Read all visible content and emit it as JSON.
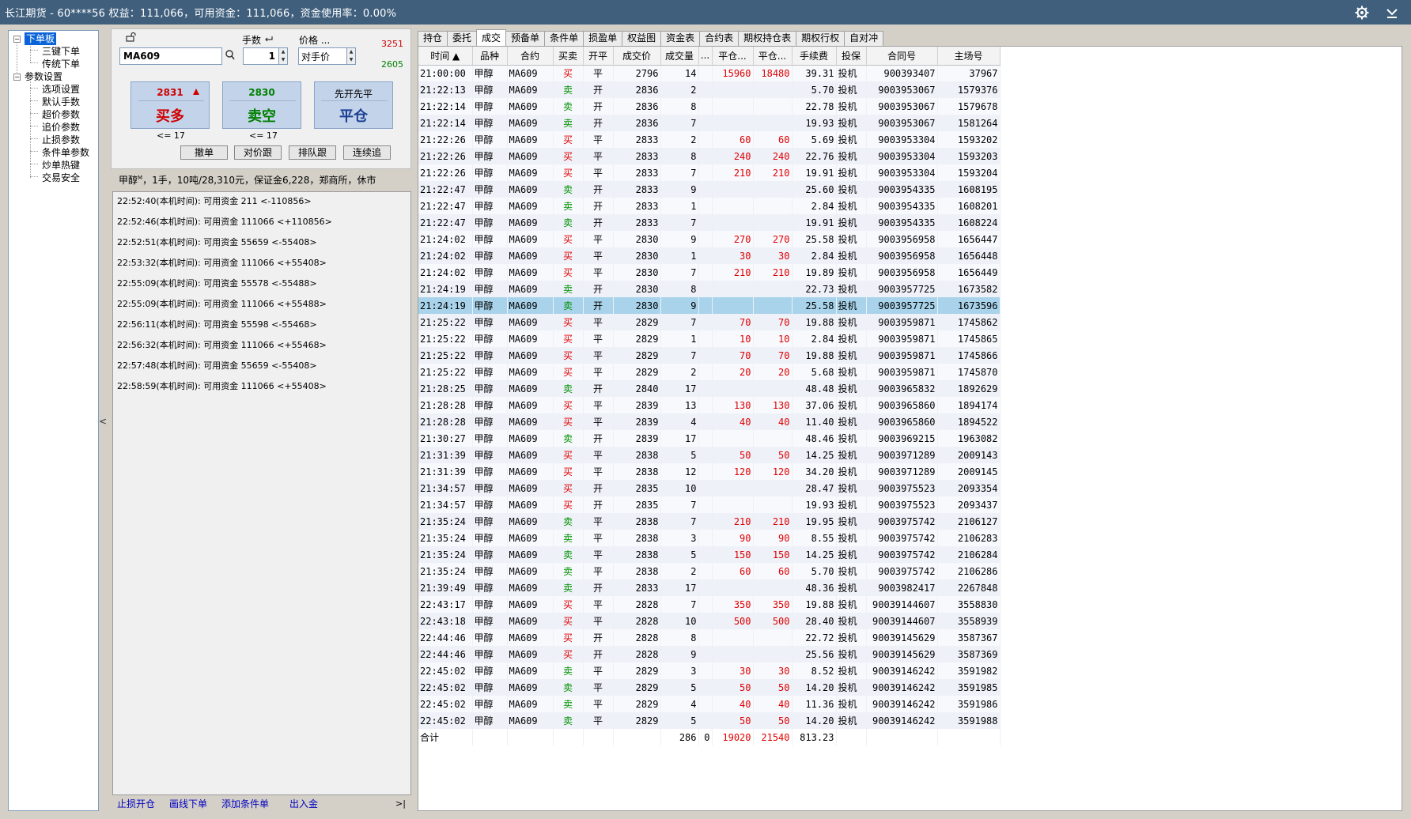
{
  "window": {
    "title": "长江期货 - 60****56  权益：111,066，可用资金：111,066，资金使用率：0.00%",
    "icons": [
      "gear-icon",
      "minimize-icon"
    ]
  },
  "tree": {
    "root1": "下单板",
    "root1_children": [
      "三键下单",
      "传统下单"
    ],
    "root2": "参数设置",
    "root2_children": [
      "选项设置",
      "默认手数",
      "超价参数",
      "追价参数",
      "止损参数",
      "条件单参数",
      "炒单热键",
      "交易安全"
    ]
  },
  "order": {
    "qty_label": "手数",
    "price_label": "价格 ...",
    "contract": "MA609",
    "qty": "1",
    "price_mode": "对手价",
    "limit_up": "3251",
    "limit_down": "2605",
    "buy_price": "2831",
    "buy_label": "买多",
    "sell_price": "2830",
    "sell_label": "卖空",
    "close_hint": "先开先平",
    "close_label": "平仓",
    "buy_limit": "<= 17",
    "sell_limit": "<= 17",
    "buttons": [
      "撤单",
      "对价跟",
      "排队跟",
      "连续追"
    ],
    "info_prefix": "甲醇",
    "info_sup": "M",
    "info_rest": "，1手，10吨/28,310元，保证金6,228，郑商所，休市"
  },
  "log": [
    "22:52:40(本机时间): 可用资金 211 <-110856>",
    "22:52:46(本机时间): 可用资金 111066 <+110856>",
    "22:52:51(本机时间): 可用资金 55659 <-55408>",
    "22:53:32(本机时间): 可用资金 111066 <+55408>",
    "22:55:09(本机时间): 可用资金 55578 <-55488>",
    "22:55:09(本机时间): 可用资金 111066 <+55488>",
    "22:56:11(本机时间): 可用资金 55598 <-55468>",
    "22:56:32(本机时间): 可用资金 111066 <+55468>",
    "22:57:48(本机时间): 可用资金 55659 <-55408>",
    "22:58:59(本机时间): 可用资金 111066 <+55408>"
  ],
  "bottom_links": [
    "止损开仓",
    "画线下单",
    "添加条件单",
    "出入金"
  ],
  "collapse_label": ">|",
  "tabs": [
    "持仓",
    "委托",
    "成交",
    "预备单",
    "条件单",
    "损盈单",
    "权益图",
    "资金表",
    "合约表",
    "期权持仓表",
    "期权行权",
    "自对冲"
  ],
  "active_tab": "成交",
  "columns": [
    "时间 ▲",
    "品种",
    "合约",
    "买卖",
    "开平",
    "成交价",
    "成交量",
    "...",
    "平仓...",
    "平仓...",
    "手续费",
    "投保",
    "合同号",
    "主场号"
  ],
  "colors": {
    "buy": "#e00000",
    "sell": "#009000",
    "selected_row": "#a8d3ea",
    "title_bar": "#3f5f7d"
  },
  "rows": [
    [
      "21:00:00",
      "甲醇",
      "MA609",
      "买",
      "平",
      "2796",
      "14",
      "",
      "15960",
      "18480",
      "39.31",
      "投机",
      "900393407",
      "37967"
    ],
    [
      "21:22:13",
      "甲醇",
      "MA609",
      "卖",
      "开",
      "2836",
      "2",
      "",
      "",
      "",
      "5.70",
      "投机",
      "9003953067",
      "1579376"
    ],
    [
      "21:22:14",
      "甲醇",
      "MA609",
      "卖",
      "开",
      "2836",
      "8",
      "",
      "",
      "",
      "22.78",
      "投机",
      "9003953067",
      "1579678"
    ],
    [
      "21:22:14",
      "甲醇",
      "MA609",
      "卖",
      "开",
      "2836",
      "7",
      "",
      "",
      "",
      "19.93",
      "投机",
      "9003953067",
      "1581264"
    ],
    [
      "21:22:26",
      "甲醇",
      "MA609",
      "买",
      "平",
      "2833",
      "2",
      "",
      "60",
      "60",
      "5.69",
      "投机",
      "9003953304",
      "1593202"
    ],
    [
      "21:22:26",
      "甲醇",
      "MA609",
      "买",
      "平",
      "2833",
      "8",
      "",
      "240",
      "240",
      "22.76",
      "投机",
      "9003953304",
      "1593203"
    ],
    [
      "21:22:26",
      "甲醇",
      "MA609",
      "买",
      "平",
      "2833",
      "7",
      "",
      "210",
      "210",
      "19.91",
      "投机",
      "9003953304",
      "1593204"
    ],
    [
      "21:22:47",
      "甲醇",
      "MA609",
      "卖",
      "开",
      "2833",
      "9",
      "",
      "",
      "",
      "25.60",
      "投机",
      "9003954335",
      "1608195"
    ],
    [
      "21:22:47",
      "甲醇",
      "MA609",
      "卖",
      "开",
      "2833",
      "1",
      "",
      "",
      "",
      "2.84",
      "投机",
      "9003954335",
      "1608201"
    ],
    [
      "21:22:47",
      "甲醇",
      "MA609",
      "卖",
      "开",
      "2833",
      "7",
      "",
      "",
      "",
      "19.91",
      "投机",
      "9003954335",
      "1608224"
    ],
    [
      "21:24:02",
      "甲醇",
      "MA609",
      "买",
      "平",
      "2830",
      "9",
      "",
      "270",
      "270",
      "25.58",
      "投机",
      "9003956958",
      "1656447"
    ],
    [
      "21:24:02",
      "甲醇",
      "MA609",
      "买",
      "平",
      "2830",
      "1",
      "",
      "30",
      "30",
      "2.84",
      "投机",
      "9003956958",
      "1656448"
    ],
    [
      "21:24:02",
      "甲醇",
      "MA609",
      "买",
      "平",
      "2830",
      "7",
      "",
      "210",
      "210",
      "19.89",
      "投机",
      "9003956958",
      "1656449"
    ],
    [
      "21:24:19",
      "甲醇",
      "MA609",
      "卖",
      "开",
      "2830",
      "8",
      "",
      "",
      "",
      "22.73",
      "投机",
      "9003957725",
      "1673582"
    ],
    [
      "21:24:19",
      "甲醇",
      "MA609",
      "卖",
      "开",
      "2830",
      "9",
      "",
      "",
      "",
      "25.58",
      "投机",
      "9003957725",
      "1673596"
    ],
    [
      "21:25:22",
      "甲醇",
      "MA609",
      "买",
      "平",
      "2829",
      "7",
      "",
      "70",
      "70",
      "19.88",
      "投机",
      "9003959871",
      "1745862"
    ],
    [
      "21:25:22",
      "甲醇",
      "MA609",
      "买",
      "平",
      "2829",
      "1",
      "",
      "10",
      "10",
      "2.84",
      "投机",
      "9003959871",
      "1745865"
    ],
    [
      "21:25:22",
      "甲醇",
      "MA609",
      "买",
      "平",
      "2829",
      "7",
      "",
      "70",
      "70",
      "19.88",
      "投机",
      "9003959871",
      "1745866"
    ],
    [
      "21:25:22",
      "甲醇",
      "MA609",
      "买",
      "平",
      "2829",
      "2",
      "",
      "20",
      "20",
      "5.68",
      "投机",
      "9003959871",
      "1745870"
    ],
    [
      "21:28:25",
      "甲醇",
      "MA609",
      "卖",
      "开",
      "2840",
      "17",
      "",
      "",
      "",
      "48.48",
      "投机",
      "9003965832",
      "1892629"
    ],
    [
      "21:28:28",
      "甲醇",
      "MA609",
      "买",
      "平",
      "2839",
      "13",
      "",
      "130",
      "130",
      "37.06",
      "投机",
      "9003965860",
      "1894174"
    ],
    [
      "21:28:28",
      "甲醇",
      "MA609",
      "买",
      "平",
      "2839",
      "4",
      "",
      "40",
      "40",
      "11.40",
      "投机",
      "9003965860",
      "1894522"
    ],
    [
      "21:30:27",
      "甲醇",
      "MA609",
      "卖",
      "开",
      "2839",
      "17",
      "",
      "",
      "",
      "48.46",
      "投机",
      "9003969215",
      "1963082"
    ],
    [
      "21:31:39",
      "甲醇",
      "MA609",
      "买",
      "平",
      "2838",
      "5",
      "",
      "50",
      "50",
      "14.25",
      "投机",
      "9003971289",
      "2009143"
    ],
    [
      "21:31:39",
      "甲醇",
      "MA609",
      "买",
      "平",
      "2838",
      "12",
      "",
      "120",
      "120",
      "34.20",
      "投机",
      "9003971289",
      "2009145"
    ],
    [
      "21:34:57",
      "甲醇",
      "MA609",
      "买",
      "开",
      "2835",
      "10",
      "",
      "",
      "",
      "28.47",
      "投机",
      "9003975523",
      "2093354"
    ],
    [
      "21:34:57",
      "甲醇",
      "MA609",
      "买",
      "开",
      "2835",
      "7",
      "",
      "",
      "",
      "19.93",
      "投机",
      "9003975523",
      "2093437"
    ],
    [
      "21:35:24",
      "甲醇",
      "MA609",
      "卖",
      "平",
      "2838",
      "7",
      "",
      "210",
      "210",
      "19.95",
      "投机",
      "9003975742",
      "2106127"
    ],
    [
      "21:35:24",
      "甲醇",
      "MA609",
      "卖",
      "平",
      "2838",
      "3",
      "",
      "90",
      "90",
      "8.55",
      "投机",
      "9003975742",
      "2106283"
    ],
    [
      "21:35:24",
      "甲醇",
      "MA609",
      "卖",
      "平",
      "2838",
      "5",
      "",
      "150",
      "150",
      "14.25",
      "投机",
      "9003975742",
      "2106284"
    ],
    [
      "21:35:24",
      "甲醇",
      "MA609",
      "卖",
      "平",
      "2838",
      "2",
      "",
      "60",
      "60",
      "5.70",
      "投机",
      "9003975742",
      "2106286"
    ],
    [
      "21:39:49",
      "甲醇",
      "MA609",
      "卖",
      "开",
      "2833",
      "17",
      "",
      "",
      "",
      "48.36",
      "投机",
      "9003982417",
      "2267848"
    ],
    [
      "22:43:17",
      "甲醇",
      "MA609",
      "买",
      "平",
      "2828",
      "7",
      "",
      "350",
      "350",
      "19.88",
      "投机",
      "90039144607",
      "3558830"
    ],
    [
      "22:43:18",
      "甲醇",
      "MA609",
      "买",
      "平",
      "2828",
      "10",
      "",
      "500",
      "500",
      "28.40",
      "投机",
      "90039144607",
      "3558939"
    ],
    [
      "22:44:46",
      "甲醇",
      "MA609",
      "买",
      "开",
      "2828",
      "8",
      "",
      "",
      "",
      "22.72",
      "投机",
      "90039145629",
      "3587367"
    ],
    [
      "22:44:46",
      "甲醇",
      "MA609",
      "买",
      "开",
      "2828",
      "9",
      "",
      "",
      "",
      "25.56",
      "投机",
      "90039145629",
      "3587369"
    ],
    [
      "22:45:02",
      "甲醇",
      "MA609",
      "卖",
      "平",
      "2829",
      "3",
      "",
      "30",
      "30",
      "8.52",
      "投机",
      "90039146242",
      "3591982"
    ],
    [
      "22:45:02",
      "甲醇",
      "MA609",
      "卖",
      "平",
      "2829",
      "5",
      "",
      "50",
      "50",
      "14.20",
      "投机",
      "90039146242",
      "3591985"
    ],
    [
      "22:45:02",
      "甲醇",
      "MA609",
      "卖",
      "平",
      "2829",
      "4",
      "",
      "40",
      "40",
      "11.36",
      "投机",
      "90039146242",
      "3591986"
    ],
    [
      "22:45:02",
      "甲醇",
      "MA609",
      "卖",
      "平",
      "2829",
      "5",
      "",
      "50",
      "50",
      "14.20",
      "投机",
      "90039146242",
      "3591988"
    ]
  ],
  "selected_row": 14,
  "totals": {
    "label": "合计",
    "volume": "286",
    "col8": "0",
    "close1": "19020",
    "close2": "21540",
    "fee": "813.23"
  }
}
